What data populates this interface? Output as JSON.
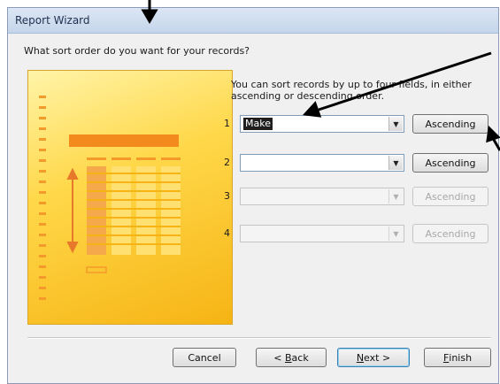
{
  "window": {
    "title": "Report Wizard"
  },
  "prompt": "What sort order do you want for your records?",
  "info": "You can sort records by up to four fields, in either ascending or descending order.",
  "sort_rows": [
    {
      "number": "1",
      "field": "Make",
      "order": "Ascending",
      "enabled": true
    },
    {
      "number": "2",
      "field": "",
      "order": "Ascending",
      "enabled": true
    },
    {
      "number": "3",
      "field": "",
      "order": "Ascending",
      "enabled": false
    },
    {
      "number": "4",
      "field": "",
      "order": "Ascending",
      "enabled": false
    }
  ],
  "footer": {
    "cancel": "Cancel",
    "back_mnemonic": "B",
    "back_prefix": "< ",
    "back_rest": "ack",
    "next_mnemonic": "N",
    "next_rest": "ext >",
    "finish_mnemonic": "F",
    "finish_rest": "inish"
  },
  "colors": {
    "illustration": "#f6b414",
    "accent_bar": "#f28a1e",
    "annotation_arrows": "#000000"
  },
  "icons": {
    "dropdown": "triangle-down",
    "illustration": "report-layout-preview"
  }
}
